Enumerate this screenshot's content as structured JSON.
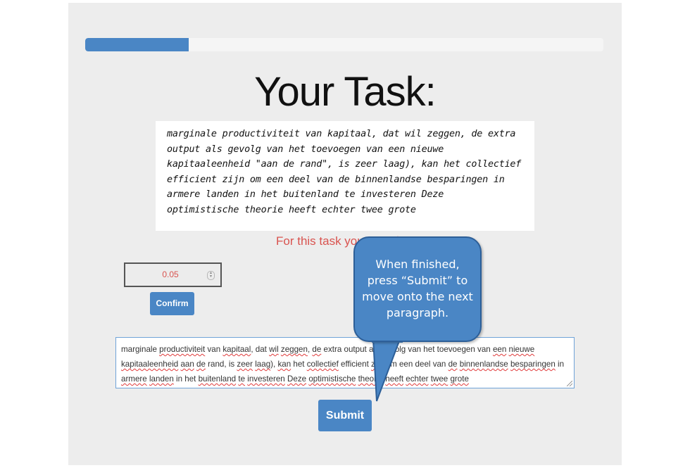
{
  "progress": {
    "percent": 20
  },
  "heading": "Your Task:",
  "task": {
    "lines": [
      "marginale productiviteit van kapitaal, dat wil zeggen, de extra",
      "output als gevolg van het toevoegen van een nieuwe",
      "kapitaaleenheid \"aan de rand\", is zeer laag), kan het collectief",
      "efficient zijn om een deel van de binnenlandse besparingen in",
      "armere landen in het buitenland te investeren Deze",
      "optimistische theorie heeft echter twee grote"
    ]
  },
  "earn_text": "For this task you earn $0.05",
  "amount": {
    "value": "0.05"
  },
  "confirm_label": "Confirm",
  "answer": {
    "parts": [
      {
        "t": "marginale ",
        "s": false
      },
      {
        "t": "productiviteit",
        "s": true
      },
      {
        "t": " van ",
        "s": false
      },
      {
        "t": "kapitaal",
        "s": true
      },
      {
        "t": ", dat ",
        "s": false
      },
      {
        "t": "wil",
        "s": true
      },
      {
        "t": " ",
        "s": false
      },
      {
        "t": "zeggen",
        "s": true
      },
      {
        "t": ", ",
        "s": false
      },
      {
        "t": "de",
        "s": true
      },
      {
        "t": " extra output als gevolg van het toevoegen van ",
        "s": false
      },
      {
        "t": "een",
        "s": true
      },
      {
        "t": " ",
        "s": false
      },
      {
        "t": "nieuwe",
        "s": true
      },
      {
        "t": " ",
        "s": false
      },
      {
        "t": "kapitaaleenheid",
        "s": true
      },
      {
        "t": " ",
        "s": false
      },
      {
        "t": "aan",
        "s": true
      },
      {
        "t": " ",
        "s": false
      },
      {
        "t": "de",
        "s": true
      },
      {
        "t": " rand, is ",
        "s": false
      },
      {
        "t": "zeer",
        "s": true
      },
      {
        "t": " ",
        "s": false
      },
      {
        "t": "laag",
        "s": true
      },
      {
        "t": "), ",
        "s": false
      },
      {
        "t": "kan",
        "s": true
      },
      {
        "t": " het ",
        "s": false
      },
      {
        "t": "collectief",
        "s": true
      },
      {
        "t": " efficient ",
        "s": false
      },
      {
        "t": "zijn",
        "s": true
      },
      {
        "t": " om een deel van ",
        "s": false
      },
      {
        "t": "de",
        "s": true
      },
      {
        "t": " ",
        "s": false
      },
      {
        "t": "binnenlandse",
        "s": true
      },
      {
        "t": " ",
        "s": false
      },
      {
        "t": "besparingen",
        "s": true
      },
      {
        "t": " in ",
        "s": false
      },
      {
        "t": "armere",
        "s": true
      },
      {
        "t": " ",
        "s": false
      },
      {
        "t": "landen",
        "s": true
      },
      {
        "t": " in het ",
        "s": false
      },
      {
        "t": "buitenland",
        "s": true
      },
      {
        "t": " ",
        "s": false
      },
      {
        "t": "te",
        "s": true
      },
      {
        "t": " ",
        "s": false
      },
      {
        "t": "investeren",
        "s": true
      },
      {
        "t": " ",
        "s": false
      },
      {
        "t": "Deze",
        "s": true
      },
      {
        "t": " ",
        "s": false
      },
      {
        "t": "optimistische",
        "s": true
      },
      {
        "t": " ",
        "s": false
      },
      {
        "t": "theorie",
        "s": true
      },
      {
        "t": " ",
        "s": false
      },
      {
        "t": "heeft",
        "s": true
      },
      {
        "t": " ",
        "s": false
      },
      {
        "t": "echter",
        "s": true
      },
      {
        "t": " ",
        "s": false
      },
      {
        "t": "twee",
        "s": true
      },
      {
        "t": " ",
        "s": false
      },
      {
        "t": "grote",
        "s": true
      }
    ]
  },
  "submit_label": "Submit",
  "callout": {
    "lines": [
      "When finished,",
      "press “Submit” to",
      "move onto the next",
      "paragraph."
    ]
  },
  "colors": {
    "accent": "#4a86c5",
    "earn_text": "#d9534f",
    "panel_bg": "#ededed"
  }
}
